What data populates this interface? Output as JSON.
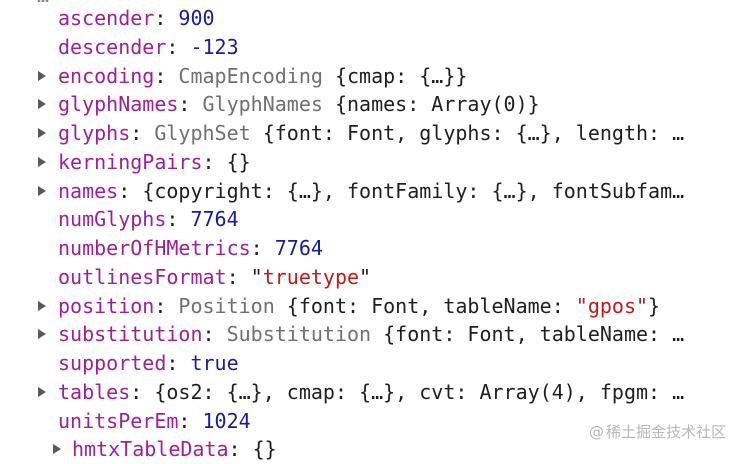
{
  "top_clip": "…",
  "rows": [
    {
      "key": "ascender",
      "parts": [
        {
          "t": "900",
          "c": "num"
        }
      ],
      "expandable": false,
      "nested": false
    },
    {
      "key": "descender",
      "parts": [
        {
          "t": "-123",
          "c": "num"
        }
      ],
      "expandable": false,
      "nested": false
    },
    {
      "key": "encoding",
      "parts": [
        {
          "t": "CmapEncoding ",
          "c": "cls"
        },
        {
          "t": "{cmap: {…}}",
          "c": "plain"
        }
      ],
      "expandable": true,
      "nested": false
    },
    {
      "key": "glyphNames",
      "parts": [
        {
          "t": "GlyphNames ",
          "c": "cls"
        },
        {
          "t": "{names: Array(0)}",
          "c": "plain"
        }
      ],
      "expandable": true,
      "nested": false
    },
    {
      "key": "glyphs",
      "parts": [
        {
          "t": "GlyphSet ",
          "c": "cls"
        },
        {
          "t": "{font: Font, glyphs: {…}, length: …",
          "c": "plain"
        }
      ],
      "expandable": true,
      "nested": false
    },
    {
      "key": "kerningPairs",
      "parts": [
        {
          "t": "{}",
          "c": "plain"
        }
      ],
      "expandable": true,
      "nested": false
    },
    {
      "key": "names",
      "parts": [
        {
          "t": "{copyright: {…}, fontFamily: {…}, fontSubfam…",
          "c": "plain"
        }
      ],
      "expandable": true,
      "nested": false
    },
    {
      "key": "numGlyphs",
      "parts": [
        {
          "t": "7764",
          "c": "num"
        }
      ],
      "expandable": false,
      "nested": false
    },
    {
      "key": "numberOfHMetrics",
      "parts": [
        {
          "t": "7764",
          "c": "num"
        }
      ],
      "expandable": false,
      "nested": false
    },
    {
      "key": "outlinesFormat",
      "parts": [
        {
          "t": "\"",
          "c": "plain"
        },
        {
          "t": "truetype",
          "c": "str"
        },
        {
          "t": "\"",
          "c": "plain"
        }
      ],
      "expandable": false,
      "nested": false
    },
    {
      "key": "position",
      "parts": [
        {
          "t": "Position ",
          "c": "cls"
        },
        {
          "t": "{font: Font, tableName: ",
          "c": "plain"
        },
        {
          "t": "\"gpos\"",
          "c": "str"
        },
        {
          "t": "}",
          "c": "plain"
        }
      ],
      "expandable": true,
      "nested": false
    },
    {
      "key": "substitution",
      "parts": [
        {
          "t": "Substitution ",
          "c": "cls"
        },
        {
          "t": "{font: Font, tableName: …",
          "c": "plain"
        }
      ],
      "expandable": true,
      "nested": false
    },
    {
      "key": "supported",
      "parts": [
        {
          "t": "true",
          "c": "bool"
        }
      ],
      "expandable": false,
      "nested": false
    },
    {
      "key": "tables",
      "parts": [
        {
          "t": "{os2: {…}, cmap: {…}, cvt: Array(4), fpgm: …",
          "c": "plain"
        }
      ],
      "expandable": true,
      "nested": false
    },
    {
      "key": "unitsPerEm",
      "parts": [
        {
          "t": "1024",
          "c": "num"
        }
      ],
      "expandable": false,
      "nested": false
    },
    {
      "key": "hmtxTableData",
      "parts": [
        {
          "t": "{}",
          "c": "plain"
        }
      ],
      "expandable": true,
      "nested": true
    }
  ],
  "watermark": {
    "at": "@",
    "text": "稀土掘金技术社区"
  }
}
